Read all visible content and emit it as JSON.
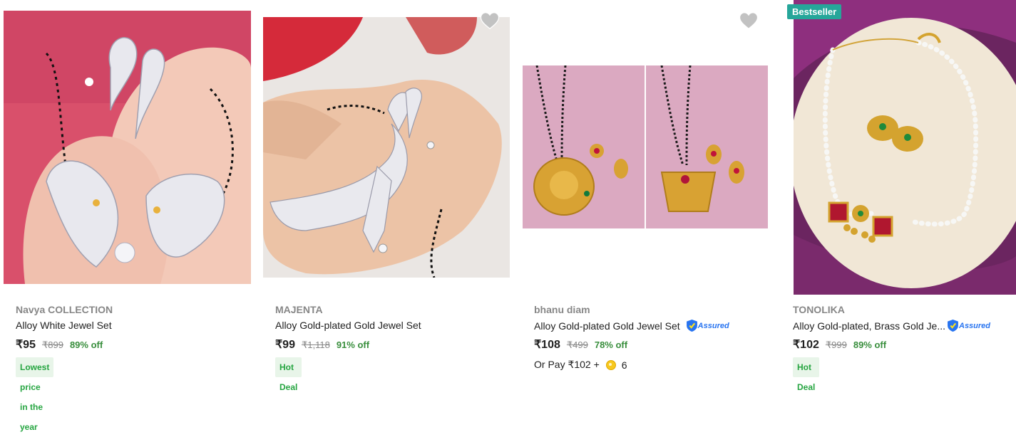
{
  "colors": {
    "brand_grey": "#878787",
    "text": "#212121",
    "green_discount": "#388e3c",
    "tag_bg": "#e8f5e9",
    "tag_text": "#26a541",
    "bestseller_bg": "#26a69a",
    "assured_blue": "#2874f0",
    "heart_grey": "#c2c2c2"
  },
  "products": [
    {
      "brand": "Navya COLLECTION",
      "title": "Alloy White Jewel Set",
      "price": "₹95",
      "mrp": "₹899",
      "discount": "89% off",
      "tag": "Lowest price in the year",
      "image_alt": "Peacock mangalsutra jewel set on hand"
    },
    {
      "brand": "MAJENTA",
      "title": "Alloy Gold-plated Gold Jewel Set",
      "price": "₹99",
      "mrp": "₹1,118",
      "discount": "91% off",
      "tag": "Hot Deal",
      "image_alt": "Silver mangalsutra set on hand",
      "wishlist_icon": "heart-icon"
    },
    {
      "brand": "bhanu diam",
      "title": "Alloy Gold-plated Gold Jewel Set",
      "assured": "Assured",
      "price": "₹108",
      "mrp": "₹499",
      "discount": "78% off",
      "or_pay_text": "Or Pay ₹102 +",
      "coins": "6",
      "image_alt": "Two gold mangalsutra sets on pink background",
      "wishlist_icon": "heart-icon"
    },
    {
      "badge": "Bestseller",
      "brand": "TONOLIKA",
      "title": "Alloy Gold-plated, Brass Gold Je...",
      "assured": "Assured",
      "price": "₹102",
      "mrp": "₹999",
      "discount": "89% off",
      "tag": "Hot Deal",
      "image_alt": "Pearl choker necklace with earrings on cloth"
    }
  ]
}
